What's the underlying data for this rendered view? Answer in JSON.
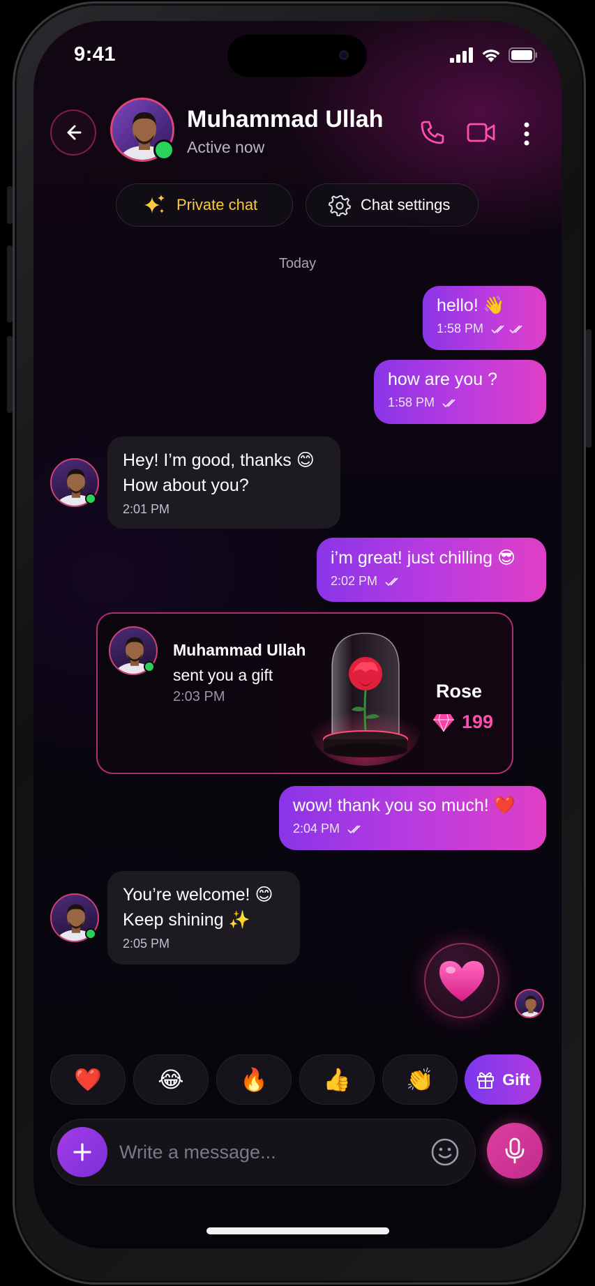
{
  "status": {
    "time": "9:41"
  },
  "header": {
    "contact_name": "Muhammad Ullah",
    "contact_status": "Active now",
    "actions": [
      "back-icon",
      "phone-icon",
      "video-icon",
      "more-icon"
    ]
  },
  "pills": {
    "private_chat": "Private chat",
    "chat_settings": "Chat settings"
  },
  "date_divider": "Today",
  "messages": [
    {
      "dir": "out",
      "text": "hello! 👋",
      "time": "1:58 PM"
    },
    {
      "dir": "out",
      "text": "how are you ?",
      "time": "1:58 PM"
    },
    {
      "dir": "in",
      "line1": "Hey! I’m good, thanks 😊",
      "line2": "How about you?",
      "time": "2:01 PM"
    },
    {
      "dir": "out",
      "text": "i’m great! just chilling 😎",
      "time": "2:02 PM"
    },
    {
      "dir": "out",
      "text": "wow! thank you so much! ❤️",
      "time": "2:04 PM"
    },
    {
      "dir": "in",
      "line1": "You’re welcome! 😊",
      "line2": "Keep shining ✨",
      "time": "2:05 PM"
    }
  ],
  "gift": {
    "sender": "Muhammad Ullah",
    "caption": "sent you a gift",
    "time": "2:03 PM",
    "item_name": "Rose",
    "price": "199"
  },
  "reactions": [
    "❤️",
    "😂",
    "🔥",
    "👍",
    "👏"
  ],
  "gift_button": "Gift",
  "composer": {
    "placeholder": "Write a message..."
  },
  "colors": {
    "accent_pink": "#e03fc6",
    "accent_purple": "#8a35e8",
    "online": "#2ad15a"
  }
}
